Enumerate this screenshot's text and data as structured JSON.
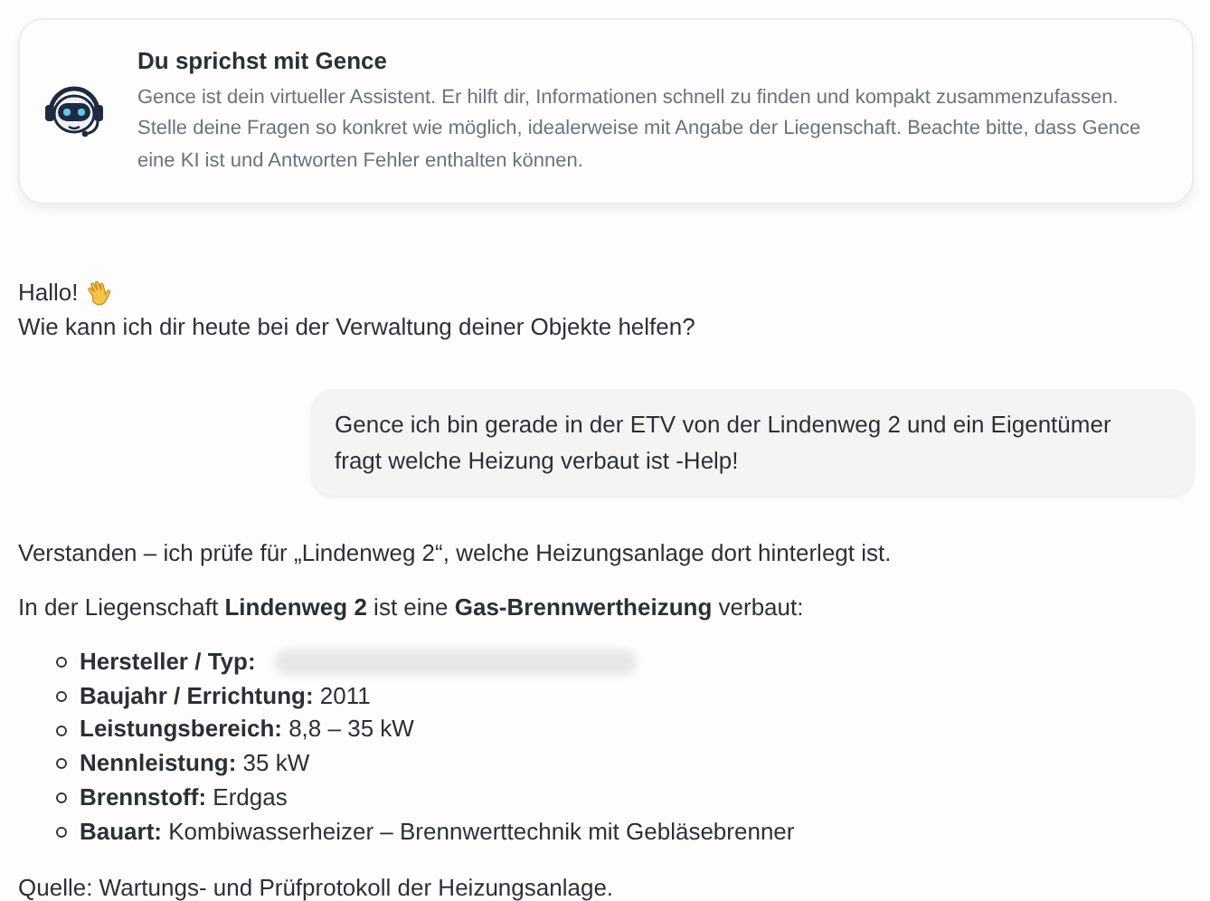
{
  "info_card": {
    "title": "Du sprichst mit Gence",
    "text": "Gence ist dein virtueller Assistent. Er hilft dir, Informationen schnell zu finden und kompakt zusammenzufassen. Stelle deine Fragen so konkret wie möglich, idealerweise mit Angabe der Liegenschaft. Beachte bitte, dass Gence eine KI ist und Antworten Fehler enthalten können."
  },
  "messages": [
    {
      "kind": "greeting",
      "lines": [
        "Hallo!",
        "Wie kann ich dir heute bei der Verwaltung deiner Objekte helfen?"
      ]
    },
    {
      "kind": "user",
      "text": "Gence ich bin gerade in der ETV von der Lindenweg 2 und ein Eigentümer fragt welche Heizung verbaut ist -Help!"
    },
    {
      "kind": "answer",
      "paragraphs": [
        "Verstanden – ich prüfe für „Lindenweg 2“, welche Heizungsanlage dort hinterlegt ist.",
        "In der Liegenschaft **Lindenweg 2** ist eine **Gas-Brennwertheizung** verbaut:"
      ],
      "facts": [
        {
          "kind": "redacted",
          "label": "Hersteller / Typ:"
        },
        {
          "kind": "text",
          "label": "Baujahr / Errichtung:",
          "value": "2011"
        },
        {
          "kind": "text",
          "label": "Leistungsbereich:",
          "value": "8,8 – 35 kW"
        },
        {
          "kind": "text",
          "label": "Nennleistung:",
          "value": "35 kW"
        },
        {
          "kind": "text",
          "label": "Brennstoff:",
          "value": "Erdgas"
        },
        {
          "kind": "text",
          "label": "Bauart:",
          "value": "Kombiwasserheizer – Brennwerttechnik mit Gebläsebrenner"
        }
      ],
      "source": "Quelle: Wartungs- und Prüfprotokoll der Heizungsanlage."
    }
  ]
}
